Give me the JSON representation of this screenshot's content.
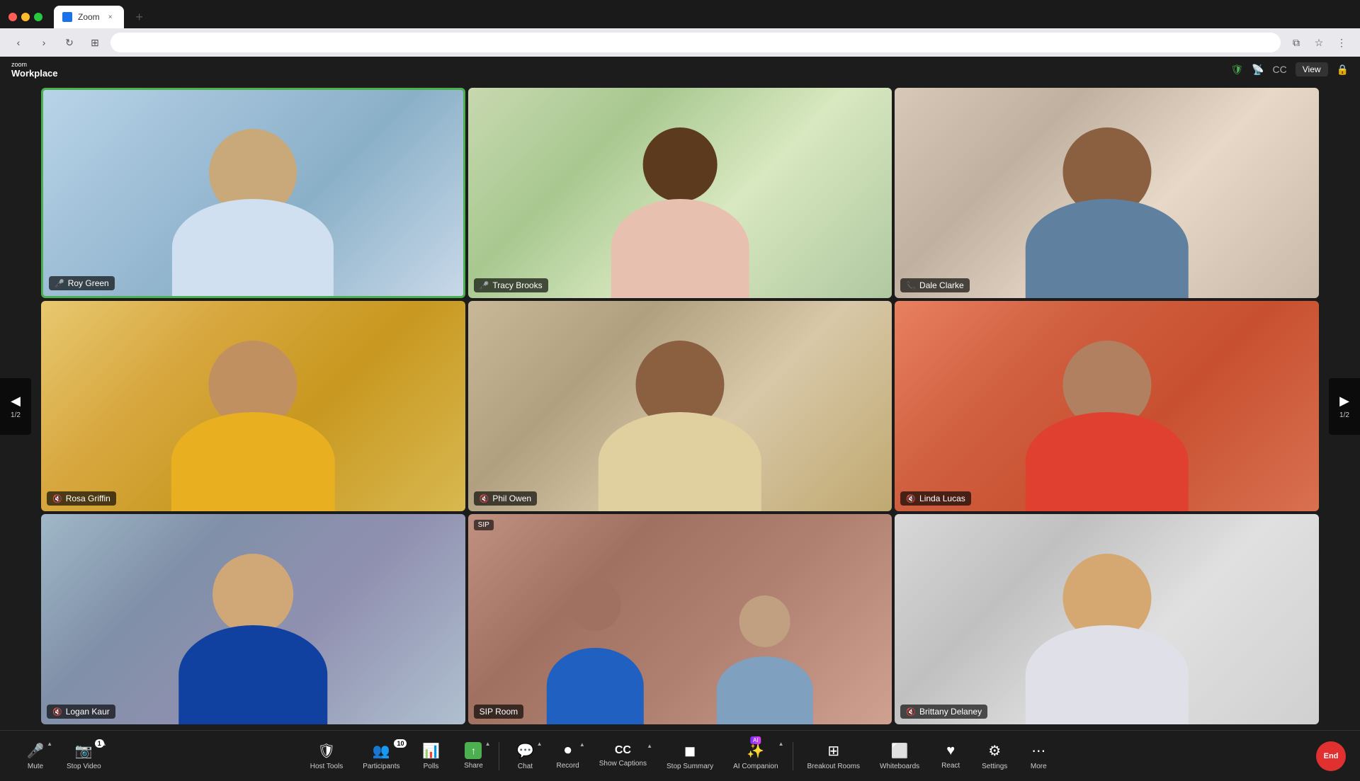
{
  "browser": {
    "tab_title": "Zoom",
    "tab_favicon": "zoom",
    "new_tab_label": "+",
    "nav_back": "‹",
    "nav_forward": "›",
    "nav_refresh": "↻",
    "nav_tabs": "⊞",
    "address": "",
    "bookmark_icon": "☆",
    "menu_icon": "⋮",
    "window_icon": "⧉"
  },
  "zoom_header": {
    "logo_top": "zoom",
    "logo_bottom": "Workplace",
    "security_icon": "🛡",
    "wifi_icon": "📶",
    "captions_icon": "CC",
    "view_label": "View",
    "lock_icon": "🔒"
  },
  "nav": {
    "left_arrow": "◀",
    "right_arrow": "▶",
    "left_page": "1/2",
    "right_page": "1/2"
  },
  "participants": [
    {
      "id": "roy-green",
      "name": "Roy Green",
      "mic_icon": "🎤",
      "mic_muted": false,
      "active_speaker": true,
      "bg_class": "bg-1",
      "shirt_color": "#d0e0f0",
      "skin_color": "#c9a87a"
    },
    {
      "id": "tracy-brooks",
      "name": "Tracy Brooks",
      "mic_icon": "🎤",
      "mic_muted": false,
      "active_speaker": false,
      "bg_class": "bg-2",
      "shirt_color": "#e8c0b0",
      "skin_color": "#5c3a1e"
    },
    {
      "id": "dale-clarke",
      "name": "Dale Clarke",
      "mic_icon": "📞",
      "mic_muted": false,
      "active_speaker": false,
      "bg_class": "bg-3",
      "shirt_color": "#6080a0",
      "skin_color": "#8a6040"
    },
    {
      "id": "rosa-griffin",
      "name": "Rosa Griffin",
      "mic_icon": "🎤",
      "mic_muted": true,
      "active_speaker": false,
      "bg_class": "bg-4",
      "shirt_color": "#e8b020",
      "skin_color": "#c09060"
    },
    {
      "id": "phil-owen",
      "name": "Phil Owen",
      "mic_icon": "🎤",
      "mic_muted": true,
      "active_speaker": false,
      "bg_class": "bg-5",
      "shirt_color": "#e0d0a0",
      "skin_color": "#8a6040"
    },
    {
      "id": "linda-lucas",
      "name": "Linda Lucas",
      "mic_icon": "🎤",
      "mic_muted": true,
      "active_speaker": false,
      "bg_class": "bg-6",
      "shirt_color": "#e04030",
      "skin_color": "#b08060"
    },
    {
      "id": "logan-kaur",
      "name": "Logan Kaur",
      "mic_icon": "🎤",
      "mic_muted": true,
      "active_speaker": false,
      "bg_class": "bg-7",
      "shirt_color": "#1040a0",
      "skin_color": "#d0a878"
    },
    {
      "id": "sip-room",
      "name": "SIP Room",
      "mic_icon": "🎤",
      "mic_muted": false,
      "active_speaker": false,
      "bg_class": "bg-8",
      "sip": true
    },
    {
      "id": "brittany-delaney",
      "name": "Brittany Delaney",
      "mic_icon": "🎤",
      "mic_muted": true,
      "active_speaker": false,
      "bg_class": "bg-9",
      "shirt_color": "#e0e0e8",
      "skin_color": "#d4a870"
    }
  ],
  "toolbar": {
    "items": [
      {
        "id": "mute",
        "icon": "🎤",
        "label": "Mute",
        "has_chevron": true
      },
      {
        "id": "stop-video",
        "icon": "📷",
        "label": "Stop Video",
        "has_chevron": true,
        "badge": "1"
      },
      {
        "id": "host-tools",
        "icon": "🛡",
        "label": "Host Tools",
        "has_chevron": false
      },
      {
        "id": "participants",
        "icon": "👥",
        "label": "Participants",
        "has_chevron": false,
        "badge": "10"
      },
      {
        "id": "polls",
        "icon": "📊",
        "label": "Polls",
        "has_chevron": false
      },
      {
        "id": "share",
        "icon": "↑",
        "label": "Share",
        "has_chevron": true,
        "active": true
      },
      {
        "id": "chat",
        "icon": "💬",
        "label": "Chat",
        "has_chevron": true
      },
      {
        "id": "record",
        "icon": "⏺",
        "label": "Record",
        "has_chevron": true
      },
      {
        "id": "show-captions",
        "icon": "CC",
        "label": "Show Captions",
        "has_chevron": true
      },
      {
        "id": "stop-summary",
        "icon": "◼",
        "label": "Stop Summary",
        "has_chevron": false
      },
      {
        "id": "ai-companion",
        "icon": "✨",
        "label": "AI Companion",
        "has_chevron": true,
        "ai": true
      },
      {
        "id": "breakout-rooms",
        "icon": "⊞",
        "label": "Breakout Rooms",
        "has_chevron": false
      },
      {
        "id": "whiteboards",
        "icon": "⬜",
        "label": "Whiteboards",
        "has_chevron": false
      },
      {
        "id": "react",
        "icon": "♥",
        "label": "React",
        "has_chevron": false
      },
      {
        "id": "settings",
        "icon": "⚙",
        "label": "Settings",
        "has_chevron": false
      },
      {
        "id": "more",
        "icon": "⋯",
        "label": "More",
        "has_chevron": false
      }
    ],
    "end_label": "End"
  }
}
